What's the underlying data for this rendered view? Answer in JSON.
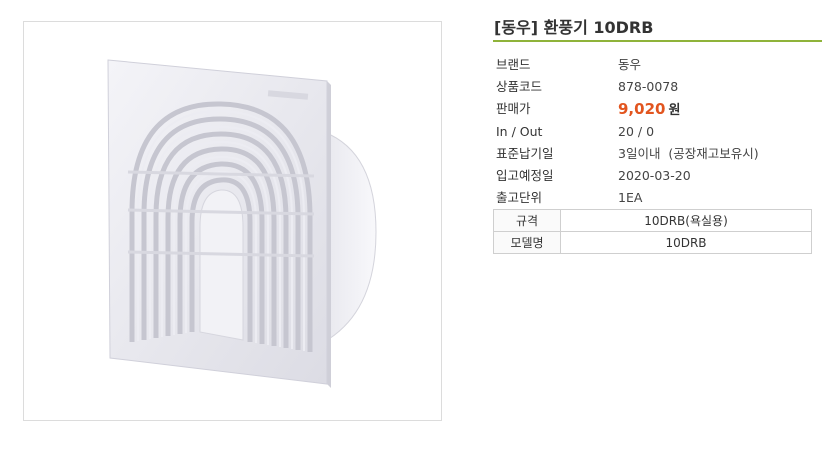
{
  "product": {
    "title": "[동우] 환풍기 10DRB",
    "image_alt": "환풍기 product photo"
  },
  "specs": [
    {
      "label": "브랜드",
      "value": "동우"
    },
    {
      "label": "상품코드",
      "value": "878-0078"
    },
    {
      "label": "판매가",
      "value": "9,020",
      "unit": "원"
    },
    {
      "label": "In / Out",
      "value": "20 / 0"
    },
    {
      "label": "표준납기일",
      "value": "3일이내  (공장재고보유시)"
    },
    {
      "label": "입고예정일",
      "value": "2020-03-20"
    },
    {
      "label": "출고단위",
      "value": "1EA"
    }
  ],
  "options": [
    {
      "label": "규격",
      "value": "10DRB(욕실용)"
    },
    {
      "label": "모델명",
      "value": "10DRB"
    }
  ],
  "colors": {
    "accent_rule": "#8fb33a",
    "price": "#e2551f"
  }
}
